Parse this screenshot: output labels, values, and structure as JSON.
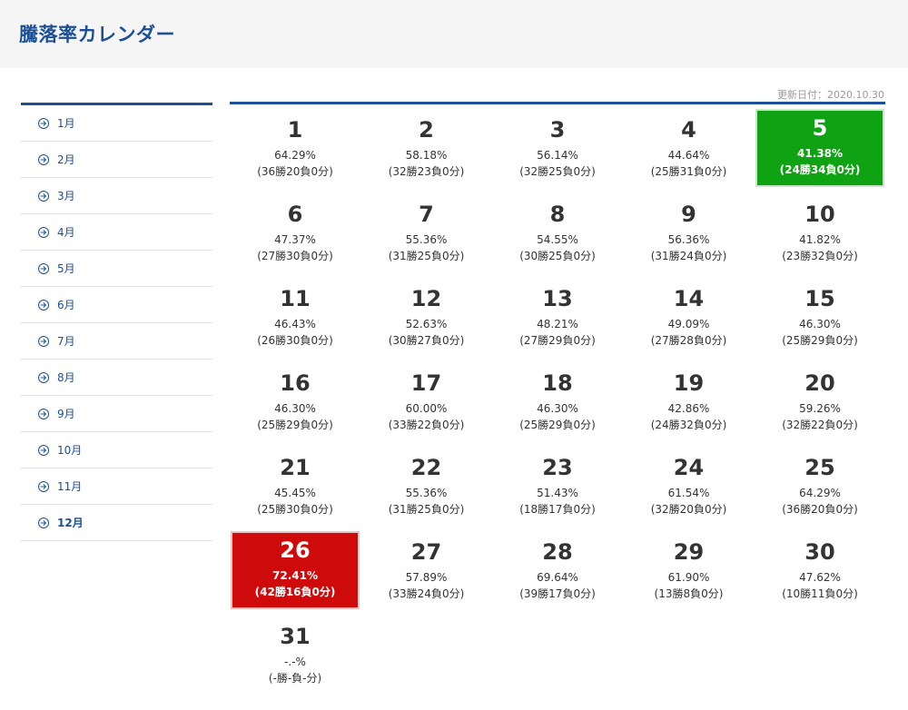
{
  "header": {
    "title": "騰落率カレンダー"
  },
  "updated": "更新日付：2020.10.30",
  "months": [
    {
      "label": "1月",
      "active": false
    },
    {
      "label": "2月",
      "active": false
    },
    {
      "label": "3月",
      "active": false
    },
    {
      "label": "4月",
      "active": false
    },
    {
      "label": "5月",
      "active": false
    },
    {
      "label": "6月",
      "active": false
    },
    {
      "label": "7月",
      "active": false
    },
    {
      "label": "8月",
      "active": false
    },
    {
      "label": "9月",
      "active": false
    },
    {
      "label": "10月",
      "active": false
    },
    {
      "label": "11月",
      "active": false
    },
    {
      "label": "12月",
      "active": true
    }
  ],
  "icon": "circle-arrow-right-icon",
  "colors": {
    "accent": "#1c4f96",
    "highlight_low": "#0fa313",
    "highlight_high": "#cf0a0a"
  },
  "days": [
    {
      "day": "1",
      "rate": "64.29%",
      "record": "(36勝20負0分)",
      "highlight": ""
    },
    {
      "day": "2",
      "rate": "58.18%",
      "record": "(32勝23負0分)",
      "highlight": ""
    },
    {
      "day": "3",
      "rate": "56.14%",
      "record": "(32勝25負0分)",
      "highlight": ""
    },
    {
      "day": "4",
      "rate": "44.64%",
      "record": "(25勝31負0分)",
      "highlight": ""
    },
    {
      "day": "5",
      "rate": "41.38%",
      "record": "(24勝34負0分)",
      "highlight": "green"
    },
    {
      "day": "6",
      "rate": "47.37%",
      "record": "(27勝30負0分)",
      "highlight": ""
    },
    {
      "day": "7",
      "rate": "55.36%",
      "record": "(31勝25負0分)",
      "highlight": ""
    },
    {
      "day": "8",
      "rate": "54.55%",
      "record": "(30勝25負0分)",
      "highlight": ""
    },
    {
      "day": "9",
      "rate": "56.36%",
      "record": "(31勝24負0分)",
      "highlight": ""
    },
    {
      "day": "10",
      "rate": "41.82%",
      "record": "(23勝32負0分)",
      "highlight": ""
    },
    {
      "day": "11",
      "rate": "46.43%",
      "record": "(26勝30負0分)",
      "highlight": ""
    },
    {
      "day": "12",
      "rate": "52.63%",
      "record": "(30勝27負0分)",
      "highlight": ""
    },
    {
      "day": "13",
      "rate": "48.21%",
      "record": "(27勝29負0分)",
      "highlight": ""
    },
    {
      "day": "14",
      "rate": "49.09%",
      "record": "(27勝28負0分)",
      "highlight": ""
    },
    {
      "day": "15",
      "rate": "46.30%",
      "record": "(25勝29負0分)",
      "highlight": ""
    },
    {
      "day": "16",
      "rate": "46.30%",
      "record": "(25勝29負0分)",
      "highlight": ""
    },
    {
      "day": "17",
      "rate": "60.00%",
      "record": "(33勝22負0分)",
      "highlight": ""
    },
    {
      "day": "18",
      "rate": "46.30%",
      "record": "(25勝29負0分)",
      "highlight": ""
    },
    {
      "day": "19",
      "rate": "42.86%",
      "record": "(24勝32負0分)",
      "highlight": ""
    },
    {
      "day": "20",
      "rate": "59.26%",
      "record": "(32勝22負0分)",
      "highlight": ""
    },
    {
      "day": "21",
      "rate": "45.45%",
      "record": "(25勝30負0分)",
      "highlight": ""
    },
    {
      "day": "22",
      "rate": "55.36%",
      "record": "(31勝25負0分)",
      "highlight": ""
    },
    {
      "day": "23",
      "rate": "51.43%",
      "record": "(18勝17負0分)",
      "highlight": ""
    },
    {
      "day": "24",
      "rate": "61.54%",
      "record": "(32勝20負0分)",
      "highlight": ""
    },
    {
      "day": "25",
      "rate": "64.29%",
      "record": "(36勝20負0分)",
      "highlight": ""
    },
    {
      "day": "26",
      "rate": "72.41%",
      "record": "(42勝16負0分)",
      "highlight": "red"
    },
    {
      "day": "27",
      "rate": "57.89%",
      "record": "(33勝24負0分)",
      "highlight": ""
    },
    {
      "day": "28",
      "rate": "69.64%",
      "record": "(39勝17負0分)",
      "highlight": ""
    },
    {
      "day": "29",
      "rate": "61.90%",
      "record": "(13勝8負0分)",
      "highlight": ""
    },
    {
      "day": "30",
      "rate": "47.62%",
      "record": "(10勝11負0分)",
      "highlight": ""
    },
    {
      "day": "31",
      "rate": "-.-%",
      "record": "(-勝-負-分)",
      "highlight": ""
    }
  ]
}
